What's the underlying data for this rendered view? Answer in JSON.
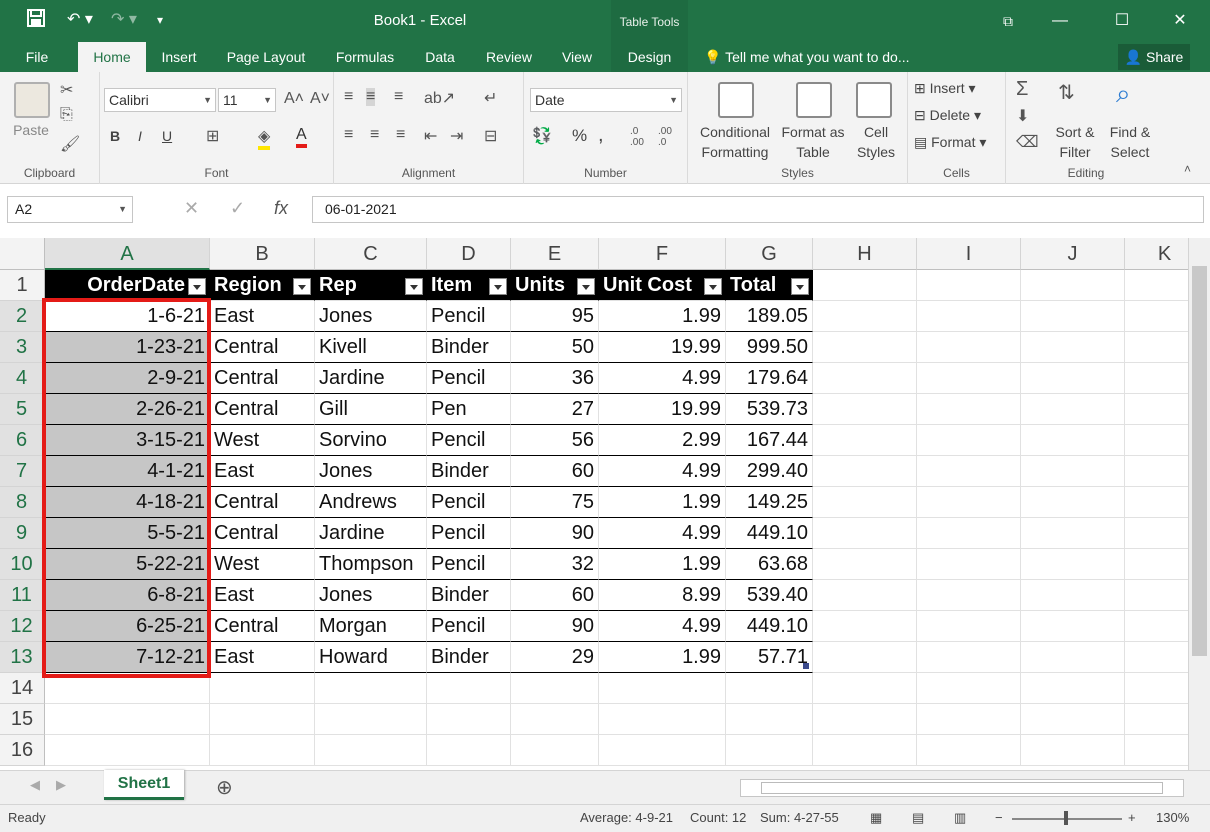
{
  "titlebar": {
    "title": "Book1 - Excel",
    "context_tab": "Table Tools",
    "save_icon": "save-icon",
    "undo_icon": "undo-icon",
    "redo_icon": "redo-icon"
  },
  "tabs": {
    "items": [
      "File",
      "Home",
      "Insert",
      "Page Layout",
      "Formulas",
      "Data",
      "Review",
      "View",
      "Design"
    ],
    "tell_me": "Tell me what you want to do...",
    "share": "Share"
  },
  "ribbon": {
    "clipboard": {
      "label": "Clipboard",
      "paste": "Paste"
    },
    "font": {
      "label": "Font",
      "name": "Calibri",
      "size": "11",
      "bold": "B",
      "italic": "I",
      "underline": "U"
    },
    "alignment": {
      "label": "Alignment"
    },
    "number": {
      "label": "Number",
      "format": "Date",
      "percent": "%",
      "comma": ","
    },
    "styles": {
      "label": "Styles",
      "conditional": "Conditional",
      "conditional2": "Formatting",
      "format_as": "Format as",
      "format_as2": "Table",
      "cell": "Cell",
      "cell2": "Styles"
    },
    "cells": {
      "label": "Cells",
      "insert": "Insert",
      "delete": "Delete",
      "format": "Format"
    },
    "editing": {
      "label": "Editing",
      "sort": "Sort &",
      "sort2": "Filter",
      "find": "Find &",
      "find2": "Select"
    }
  },
  "formula_bar": {
    "name_box": "A2",
    "fx": "fx",
    "value": "06-01-2021"
  },
  "sheet": {
    "columns": [
      "A",
      "B",
      "C",
      "D",
      "E",
      "F",
      "G",
      "H",
      "I",
      "J",
      "K"
    ],
    "rows": [
      "1",
      "2",
      "3",
      "4",
      "5",
      "6",
      "7",
      "8",
      "9",
      "10",
      "11",
      "12",
      "13",
      "14",
      "15",
      "16"
    ],
    "headers": [
      "OrderDate",
      "Region",
      "Rep",
      "Item",
      "Units",
      "Unit Cost",
      "Total"
    ],
    "data": [
      [
        "1-6-21",
        "East",
        "Jones",
        "Pencil",
        "95",
        "1.99",
        "189.05"
      ],
      [
        "1-23-21",
        "Central",
        "Kivell",
        "Binder",
        "50",
        "19.99",
        "999.50"
      ],
      [
        "2-9-21",
        "Central",
        "Jardine",
        "Pencil",
        "36",
        "4.99",
        "179.64"
      ],
      [
        "2-26-21",
        "Central",
        "Gill",
        "Pen",
        "27",
        "19.99",
        "539.73"
      ],
      [
        "3-15-21",
        "West",
        "Sorvino",
        "Pencil",
        "56",
        "2.99",
        "167.44"
      ],
      [
        "4-1-21",
        "East",
        "Jones",
        "Binder",
        "60",
        "4.99",
        "299.40"
      ],
      [
        "4-18-21",
        "Central",
        "Andrews",
        "Pencil",
        "75",
        "1.99",
        "149.25"
      ],
      [
        "5-5-21",
        "Central",
        "Jardine",
        "Pencil",
        "90",
        "4.99",
        "449.10"
      ],
      [
        "5-22-21",
        "West",
        "Thompson",
        "Pencil",
        "32",
        "1.99",
        "63.68"
      ],
      [
        "6-8-21",
        "East",
        "Jones",
        "Binder",
        "60",
        "8.99",
        "539.40"
      ],
      [
        "6-25-21",
        "Central",
        "Morgan",
        "Pencil",
        "90",
        "4.99",
        "449.10"
      ],
      [
        "7-12-21",
        "East",
        "Howard",
        "Binder",
        "29",
        "1.99",
        "57.71"
      ]
    ],
    "tab_name": "Sheet1"
  },
  "status": {
    "mode": "Ready",
    "average": "Average: 4-9-21",
    "count": "Count: 12",
    "sum": "Sum: 4-27-55",
    "zoom": "130%"
  },
  "colors": {
    "accent": "#217346",
    "highlight": "#e41b17",
    "selection": "#c6c6c6"
  }
}
